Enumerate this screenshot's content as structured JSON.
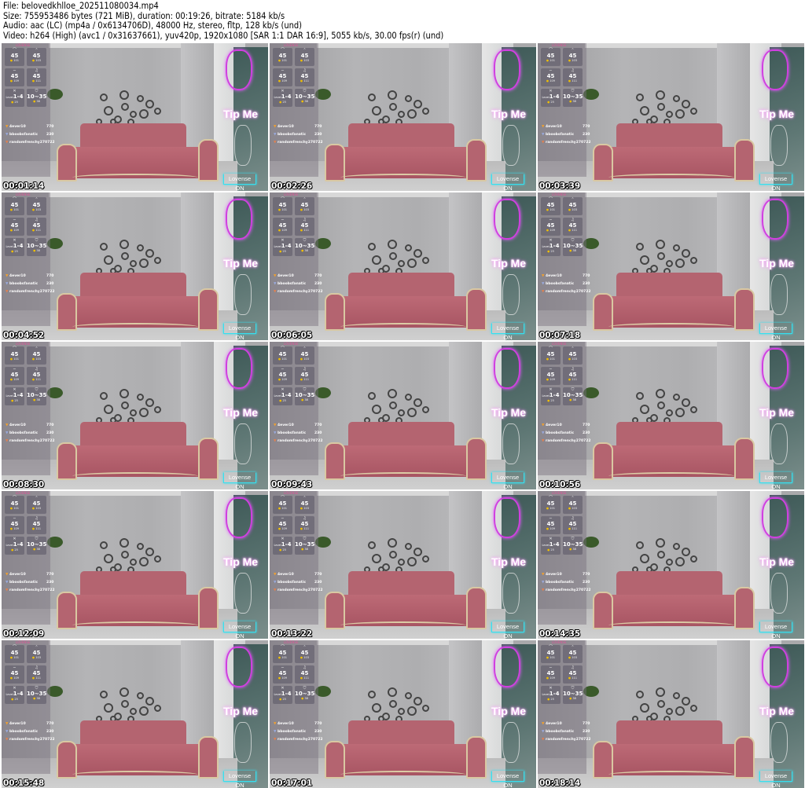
{
  "header": {
    "file": "File: belovedkhlloe_202511080034.mp4",
    "size": "Size: 755953486 bytes (721 MiB), duration: 00:19:26, bitrate: 5184 kb/s",
    "audio": "Audio: aac (LC) (mp4a / 0x6134706D), 48000 Hz, stereo, fltp, 128 kb/s (und)",
    "video": "Video: h264 (High) (avc1 / 0x31637661), yuv420p, 1920x1080 [SAR 1:1 DAR 16:9], 5055 kb/s, 30.00 fps(r) (und)"
  },
  "overlay": {
    "brand": "LOVENSE",
    "cells": [
      {
        "icon": "⌒",
        "value": "45",
        "coins": "101"
      },
      {
        "icon": "⌃",
        "value": "45",
        "coins": "103"
      },
      {
        "icon": "∼",
        "value": "45",
        "coins": "109"
      },
      {
        "icon": "♫",
        "value": "45",
        "coins": "111"
      },
      {
        "icon": "✕",
        "value": "1-4",
        "prefix": "Level",
        "coins": "25"
      },
      {
        "icon": "⛉",
        "value": "10~35",
        "coins": "38"
      }
    ],
    "leaderboard": [
      {
        "name": "4ever10",
        "amount": "770"
      },
      {
        "name": "bboobsfanatic",
        "amount": "230"
      },
      {
        "name": "randomfrenchy270722",
        "amount": ""
      }
    ],
    "tip_me": "Tip Me",
    "lovense_status": "Lovense ON"
  },
  "thumbnails": [
    "00:01:14",
    "00:02:26",
    "00:03:39",
    "00:04:52",
    "00:06:05",
    "00:07:18",
    "00:08:30",
    "00:09:43",
    "00:10:56",
    "00:12:09",
    "00:13:22",
    "00:14:35",
    "00:15:48",
    "00:17:01",
    "00:18:14"
  ],
  "colors": {
    "sofa": "#b46470",
    "neon": "#d040e0",
    "lovense": "#35e0f0"
  }
}
